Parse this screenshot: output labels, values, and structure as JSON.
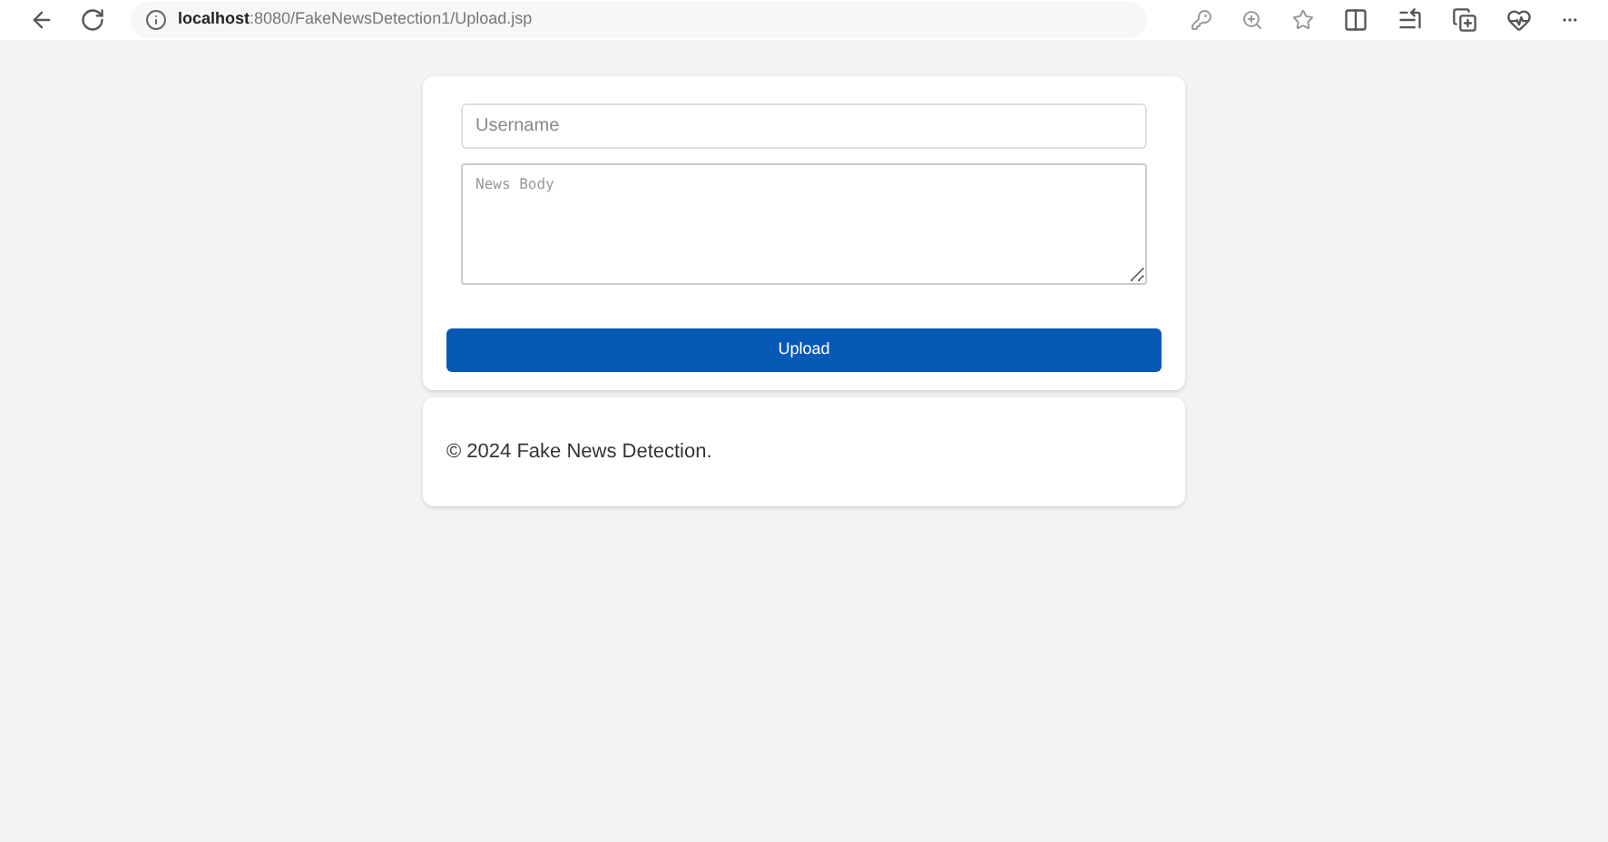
{
  "browser": {
    "url_host": "localhost",
    "url_path": ":8080/FakeNewsDetection1/Upload.jsp"
  },
  "form": {
    "username_placeholder": "Username",
    "body_placeholder": "News Body",
    "submit": "Upload"
  },
  "footer": {
    "text": "© 2024 Fake News Detection."
  }
}
